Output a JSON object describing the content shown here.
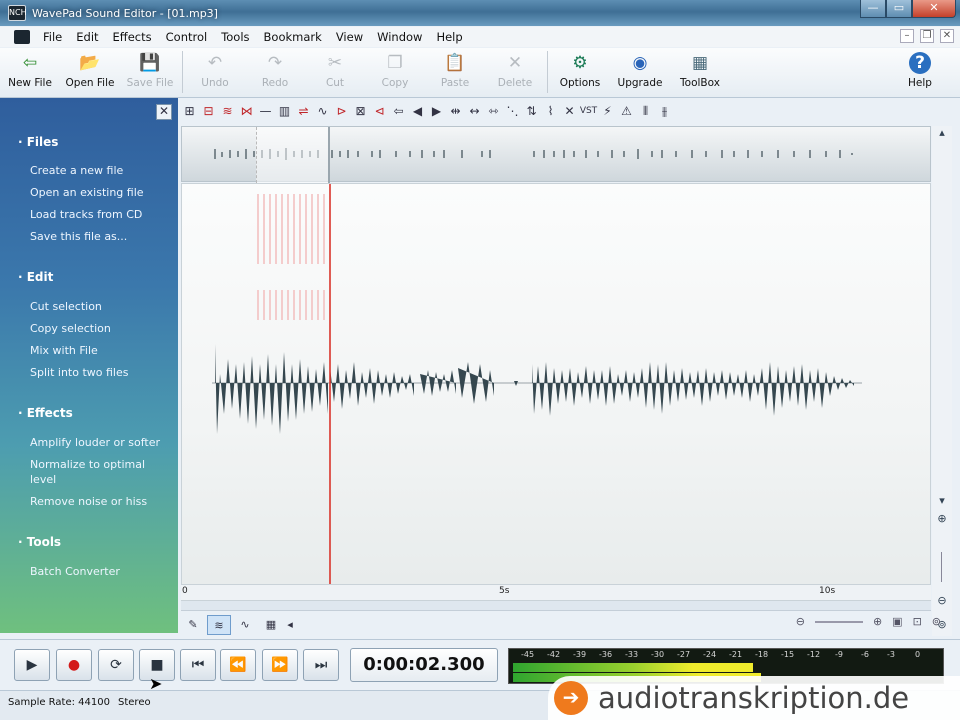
{
  "window": {
    "title": "WavePad Sound Editor - [01.mp3]",
    "app_icon": "NCH"
  },
  "menu": [
    "File",
    "Edit",
    "Effects",
    "Control",
    "Tools",
    "Bookmark",
    "View",
    "Window",
    "Help"
  ],
  "toolbar": [
    {
      "label": "New File",
      "icon": "new-file-icon",
      "glyph": "⇦",
      "enabled": true
    },
    {
      "label": "Open File",
      "icon": "open-folder-icon",
      "glyph": "📂",
      "enabled": true
    },
    {
      "label": "Save File",
      "icon": "save-disk-icon",
      "glyph": "💾",
      "enabled": false
    },
    {
      "label": "Undo",
      "icon": "undo-icon",
      "glyph": "↶",
      "enabled": false
    },
    {
      "label": "Redo",
      "icon": "redo-icon",
      "glyph": "↷",
      "enabled": false
    },
    {
      "label": "Cut",
      "icon": "scissors-icon",
      "glyph": "✂",
      "enabled": false
    },
    {
      "label": "Copy",
      "icon": "copy-icon",
      "glyph": "❐",
      "enabled": false
    },
    {
      "label": "Paste",
      "icon": "paste-icon",
      "glyph": "📋",
      "enabled": false
    },
    {
      "label": "Delete",
      "icon": "delete-x-icon",
      "glyph": "✕",
      "enabled": false
    },
    {
      "label": "Options",
      "icon": "gear-icon",
      "glyph": "⚙",
      "enabled": true
    },
    {
      "label": "Upgrade",
      "icon": "upgrade-globe-icon",
      "glyph": "◉",
      "enabled": true
    },
    {
      "label": "ToolBox",
      "icon": "toolbox-icon",
      "glyph": "▦",
      "enabled": true
    }
  ],
  "help": {
    "label": "Help",
    "glyph": "?"
  },
  "sidebar": {
    "close_glyph": "✕",
    "sections": [
      {
        "title": "· Files",
        "items": [
          "Create a new file",
          "Open an existing file",
          "Load tracks from CD",
          "Save this file as..."
        ]
      },
      {
        "title": "· Edit",
        "items": [
          "Cut selection",
          "Copy selection",
          "Mix with File",
          "Split into two files"
        ]
      },
      {
        "title": "· Effects",
        "items": [
          "Amplify louder or softer",
          "Normalize to optimal level",
          "Remove noise or hiss"
        ]
      },
      {
        "title": "· Tools",
        "items": [
          "Batch Converter"
        ]
      }
    ]
  },
  "timeline": {
    "ticks": [
      "0",
      "5s",
      "10s"
    ]
  },
  "transport": {
    "time": "0:00:02.300"
  },
  "meter": {
    "scale": [
      "-45",
      "-42",
      "-39",
      "-36",
      "-33",
      "-30",
      "-27",
      "-24",
      "-21",
      "-18",
      "-15",
      "-12",
      "-9",
      "-6",
      "-3",
      "0"
    ],
    "level_top": 0.56,
    "level_bottom": 0.58
  },
  "status": {
    "sample_rate": "Sample Rate: 44100",
    "channels": "Stereo"
  },
  "watermark": {
    "text": "audiotranskription.de",
    "glyph": "➔"
  },
  "colors": {
    "playhead": "#d9342b",
    "wave": "#35474f",
    "sidebar_top": "#2f5e9d",
    "sidebar_bottom": "#6fc07e",
    "brand": "#ef7a1d"
  }
}
